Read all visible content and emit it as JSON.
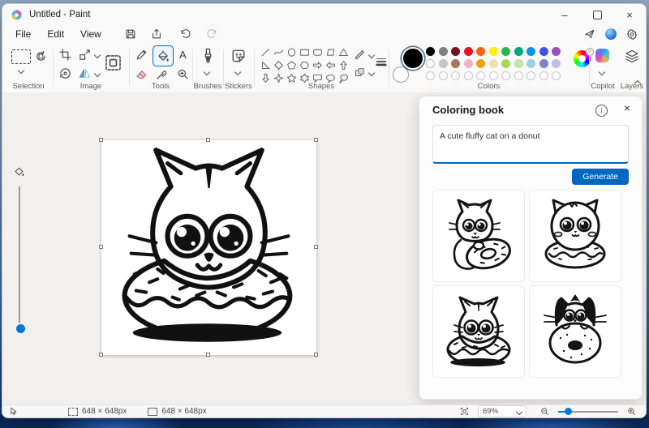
{
  "window": {
    "title": "Untitled - Paint"
  },
  "menubar": {
    "menus": [
      "File",
      "Edit",
      "View"
    ]
  },
  "icons": {
    "minimize": "–",
    "close": "×",
    "info": "i",
    "text_tool": "A",
    "plus": "+"
  },
  "ribbon": {
    "groups": [
      {
        "label": "Selection"
      },
      {
        "label": "Image"
      },
      {
        "label": "Tools"
      },
      {
        "label": "Brushes"
      },
      {
        "label": "Stickers"
      },
      {
        "label": "Shapes"
      },
      {
        "label": "Colors"
      },
      {
        "label": "Copilot"
      },
      {
        "label": "Layers"
      }
    ],
    "selected_tool": "fill",
    "shapes": [
      "line",
      "curve",
      "oval",
      "rectangle",
      "rounded-rectangle",
      "polygon",
      "triangle",
      "right-triangle",
      "diamond",
      "pentagon",
      "hexagon",
      "arrow-right",
      "arrow-left",
      "arrow-up",
      "arrow-down",
      "four-point-star",
      "five-point-star",
      "six-point-star",
      "speech-bubble-rect",
      "speech-bubble-oval",
      "thought-bubble"
    ]
  },
  "colors": {
    "color1": "#000000",
    "color2": "#ffffff",
    "palette": [
      [
        "#000000",
        "#7f7f7f",
        "#78101d",
        "#e81224",
        "#f7630c",
        "#fff100",
        "#2db34a",
        "#00a87e",
        "#0795e0",
        "#4550e5",
        "#9b4fc0"
      ],
      [
        "#ffffff",
        "#c5c5c5",
        "#a3785a",
        "#f5b0c3",
        "#f0a30a",
        "#e9e4ad",
        "#a8d65c",
        "#bfe3a8",
        "#9bd1e5",
        "#7585c9",
        "#c5bbe2"
      ]
    ],
    "empty_slots": 11,
    "accent": "#0067c0"
  },
  "panel": {
    "title": "Coloring book",
    "prompt": "A cute fluffy cat on a donut",
    "generate_label": "Generate",
    "thumbnails": [
      {
        "name": "cat-hugging-donut"
      },
      {
        "name": "fluffy-cat-on-donut"
      },
      {
        "name": "cat-head-in-donut"
      },
      {
        "name": "tuxedo-cat-behind-donut"
      }
    ]
  },
  "statusbar": {
    "selection_size": "648 × 648px",
    "canvas_size": "648 × 648px",
    "zoom_level": "69%"
  }
}
